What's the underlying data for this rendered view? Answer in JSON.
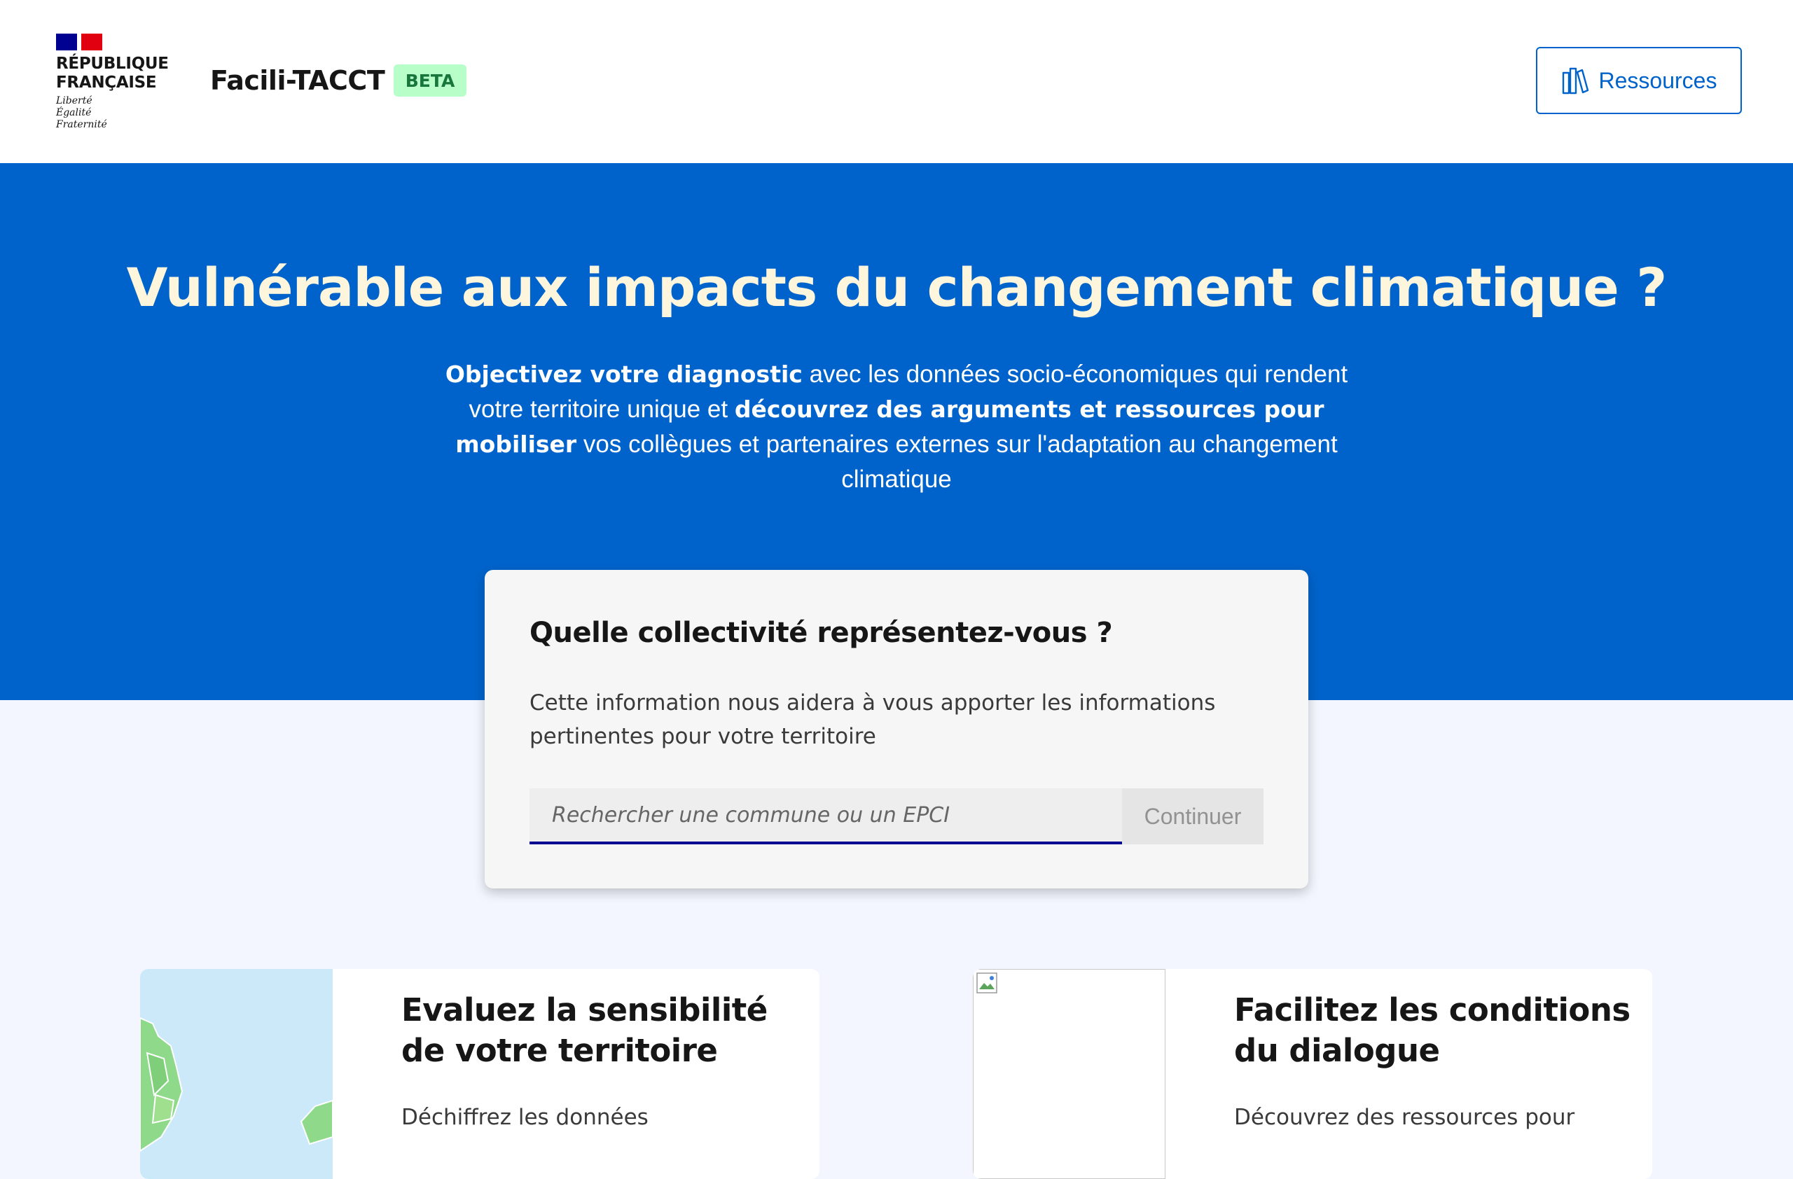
{
  "header": {
    "logo": {
      "name_lines": [
        "RÉPUBLIQUE",
        "FRANÇAISE"
      ],
      "motto_lines": [
        "Liberté",
        "Égalité",
        "Fraternité"
      ],
      "flag_colors": [
        "#000091",
        "#ffffff",
        "#e1000f"
      ]
    },
    "service_title": "Facili-TACCT",
    "badge": "BETA",
    "resources_button": {
      "label": "Ressources",
      "icon": "books-icon"
    }
  },
  "hero": {
    "title": "Vulnérable aux impacts du changement climatique ?",
    "subtitle": {
      "bold_1": "Objectivez votre diagnostic",
      "text_1": " avec les données socio-économiques qui rendent votre territoire unique et ",
      "bold_2": "découvrez des arguments et ressources pour mobiliser",
      "text_2": " vos collègues et partenaires externes sur l'adaptation au changement climatique"
    }
  },
  "search_card": {
    "question": "Quelle collectivité représentez-vous ?",
    "help": "Cette information nous aidera à vous apporter les informations pertinentes pour votre territoire",
    "input_value": "",
    "input_placeholder": "Rechercher une commune ou un EPCI",
    "button_label": "Continuer"
  },
  "features": [
    {
      "title": "Evaluez la sensibilité de votre territoire",
      "desc": "Déchiffrez les données"
    },
    {
      "title": "Facilitez les conditions du dialogue",
      "desc": "Découvrez des ressources pour"
    }
  ],
  "colors": {
    "primary_blue": "#0063cb",
    "hero_title": "#fdf6dd",
    "badge_bg": "#b8fec9",
    "badge_text": "#18753c",
    "input_border": "#000091",
    "page_bg": "#f3f6fe"
  }
}
